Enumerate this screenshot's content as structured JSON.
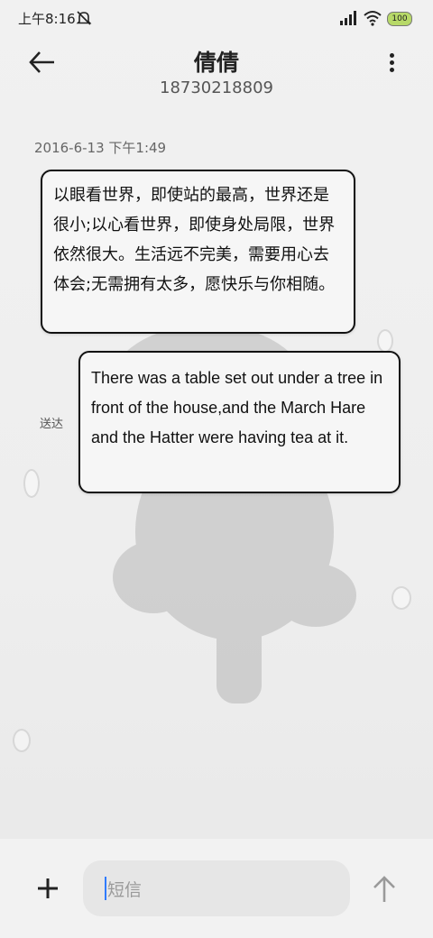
{
  "status_bar": {
    "time": "上午8:16",
    "battery": "100",
    "icons": [
      "mute-icon",
      "signal-icon",
      "wifi-icon",
      "battery-icon"
    ]
  },
  "header": {
    "contact_name": "倩倩",
    "contact_number": "18730218809",
    "back_icon": "back-arrow-icon",
    "more_icon": "more-vertical-icon"
  },
  "conversation": {
    "timestamp": "2016-6-13 下午1:49",
    "messages": [
      {
        "direction": "incoming",
        "text": "以眼看世界，即使站的最高，世界还是很小;以心看世界，即使身处局限，世界依然很大。生活远不完美，需要用心去体会;无需拥有太多，愿快乐与你相随。"
      },
      {
        "direction": "outgoing",
        "text": "There was a table set out under a tree in front of the house,and the March Hare and the Hatter were having tea at it.",
        "status": "送达"
      }
    ]
  },
  "composer": {
    "placeholder": "短信",
    "add_icon": "plus-icon",
    "send_icon": "send-arrow-up-icon"
  },
  "colors": {
    "background": "#efefef",
    "bubble": "#f6f6f6",
    "caret": "#2f7bff",
    "battery": "#b7d968"
  }
}
